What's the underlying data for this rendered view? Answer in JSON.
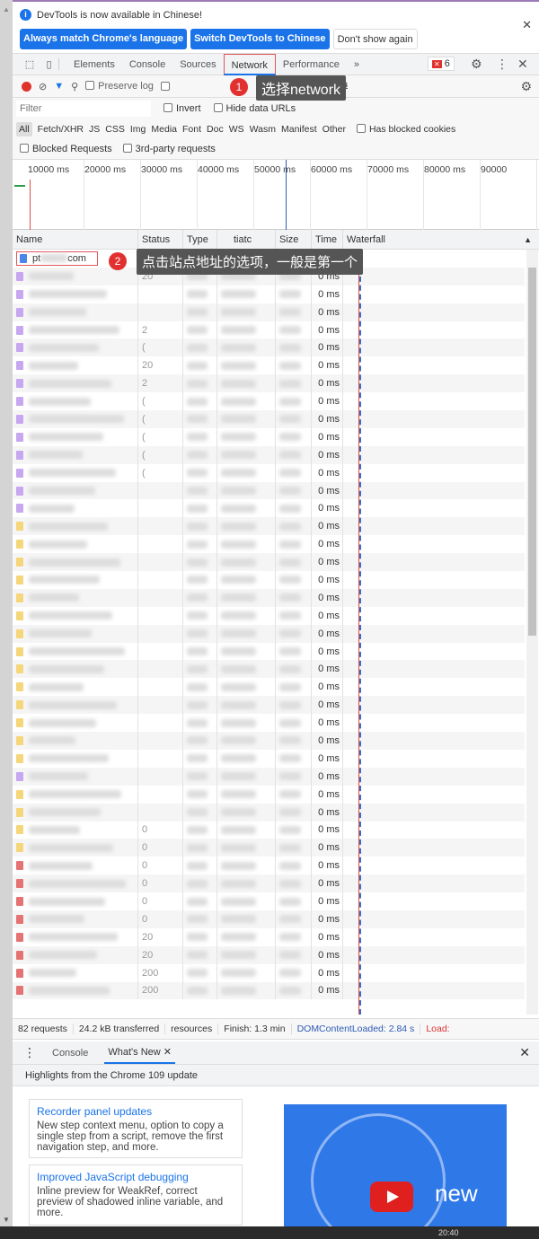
{
  "infobar": {
    "message": "DevTools is now available in Chinese!",
    "btn_match": "Always match Chrome's language",
    "btn_switch": "Switch DevTools to Chinese",
    "btn_dont": "Don't show again"
  },
  "tabs": [
    "Elements",
    "Console",
    "Sources",
    "Network",
    "Performance"
  ],
  "more_tabs": "»",
  "error_count": "6",
  "toolbar": {
    "preserve_log": "Preserve log",
    "throttle_partial": "ng"
  },
  "filter": {
    "placeholder": "Filter",
    "invert": "Invert",
    "hide_data_urls": "Hide data URLs"
  },
  "types": [
    "All",
    "Fetch/XHR",
    "JS",
    "CSS",
    "Img",
    "Media",
    "Font",
    "Doc",
    "WS",
    "Wasm",
    "Manifest",
    "Other"
  ],
  "has_blocked_cookies": "Has blocked cookies",
  "blocked_requests": "Blocked Requests",
  "third_party": "3rd-party requests",
  "overview_ticks": [
    "10000 ms",
    "20000 ms",
    "30000 ms",
    "40000 ms",
    "50000 ms",
    "60000 ms",
    "70000 ms",
    "80000 ms",
    "90000"
  ],
  "columns": {
    "name": "Name",
    "status": "Status",
    "type": "Type",
    "initiator": "tiatc",
    "size": "Size",
    "time": "Time",
    "waterfall": "Waterfall"
  },
  "first_row": {
    "name_start": "pt",
    "name_end": "com"
  },
  "rows": [
    {
      "kind": "css",
      "status": "20",
      "time": "0 ms"
    },
    {
      "kind": "css",
      "status": "",
      "time": "0 ms"
    },
    {
      "kind": "css",
      "status": "",
      "time": "0 ms"
    },
    {
      "kind": "css",
      "status": "2",
      "time": "0 ms"
    },
    {
      "kind": "css",
      "status": "(",
      "time": "0 ms"
    },
    {
      "kind": "css",
      "status": "20",
      "time": "0 ms"
    },
    {
      "kind": "css",
      "status": "2",
      "time": "0 ms"
    },
    {
      "kind": "css",
      "status": "(",
      "time": "0 ms"
    },
    {
      "kind": "css",
      "status": "(",
      "time": "0 ms"
    },
    {
      "kind": "css",
      "status": "(",
      "time": "0 ms"
    },
    {
      "kind": "css",
      "status": "(",
      "time": "0 ms"
    },
    {
      "kind": "css",
      "status": "(",
      "time": "0 ms"
    },
    {
      "kind": "css",
      "status": "",
      "time": "0 ms"
    },
    {
      "kind": "css",
      "status": "",
      "time": "0 ms"
    },
    {
      "kind": "js",
      "status": "",
      "time": "0 ms"
    },
    {
      "kind": "js",
      "status": "",
      "time": "0 ms"
    },
    {
      "kind": "js",
      "status": "",
      "time": "0 ms"
    },
    {
      "kind": "js",
      "status": "",
      "time": "0 ms"
    },
    {
      "kind": "js",
      "status": "",
      "time": "0 ms"
    },
    {
      "kind": "js",
      "status": "",
      "time": "0 ms"
    },
    {
      "kind": "js",
      "status": "",
      "time": "0 ms"
    },
    {
      "kind": "js",
      "status": "",
      "time": "0 ms"
    },
    {
      "kind": "js",
      "status": "",
      "time": "0 ms"
    },
    {
      "kind": "js",
      "status": "",
      "time": "0 ms"
    },
    {
      "kind": "js",
      "status": "",
      "time": "0 ms"
    },
    {
      "kind": "js",
      "status": "",
      "time": "0 ms"
    },
    {
      "kind": "js",
      "status": "",
      "time": "0 ms"
    },
    {
      "kind": "js",
      "status": "",
      "time": "0 ms"
    },
    {
      "kind": "css",
      "status": "",
      "time": "0 ms"
    },
    {
      "kind": "js",
      "status": "",
      "time": "0 ms"
    },
    {
      "kind": "js",
      "status": "",
      "time": "0 ms"
    },
    {
      "kind": "js",
      "status": "0",
      "time": "0 ms"
    },
    {
      "kind": "js",
      "status": "0",
      "time": "0 ms"
    },
    {
      "kind": "img",
      "status": "0",
      "time": "0 ms"
    },
    {
      "kind": "img",
      "status": "0",
      "time": "0 ms"
    },
    {
      "kind": "img",
      "status": "0",
      "time": "0 ms"
    },
    {
      "kind": "img",
      "status": "0",
      "time": "0 ms"
    },
    {
      "kind": "img",
      "status": "20",
      "time": "0 ms"
    },
    {
      "kind": "img",
      "status": "20",
      "time": "0 ms"
    },
    {
      "kind": "img",
      "status": "200",
      "time": "0 ms"
    },
    {
      "kind": "img",
      "status": "200",
      "time": "0 ms"
    }
  ],
  "kind_colors": {
    "doc": "#4a86e8",
    "css": "#c6a7f0",
    "js": "#f5d67a",
    "img": "#e57373"
  },
  "statusbar": {
    "requests": "82 requests",
    "transferred": "24.2 kB transferred",
    "resources": "resources",
    "finish": "Finish: 1.3 min",
    "dcl": "DOMContentLoaded: 2.84 s",
    "load": "Load:"
  },
  "drawer": {
    "console": "Console",
    "whats_new": "What's New",
    "highlights": "Highlights from the Chrome 109 update",
    "card1_title": "Recorder panel updates",
    "card1_text": "New step context menu, option to copy a single step from a script, remove the first navigation step, and more.",
    "card2_title": "Improved JavaScript debugging",
    "card2_text": "Inline preview for WeakRef, correct preview of shadowed inline variable, and more.",
    "video_text": "new"
  },
  "annotations": {
    "n1": "1",
    "t1": "选择network",
    "n2": "2",
    "t2": "点击站点地址的选项，一般是第一个"
  },
  "taskbar_time": "20:40"
}
